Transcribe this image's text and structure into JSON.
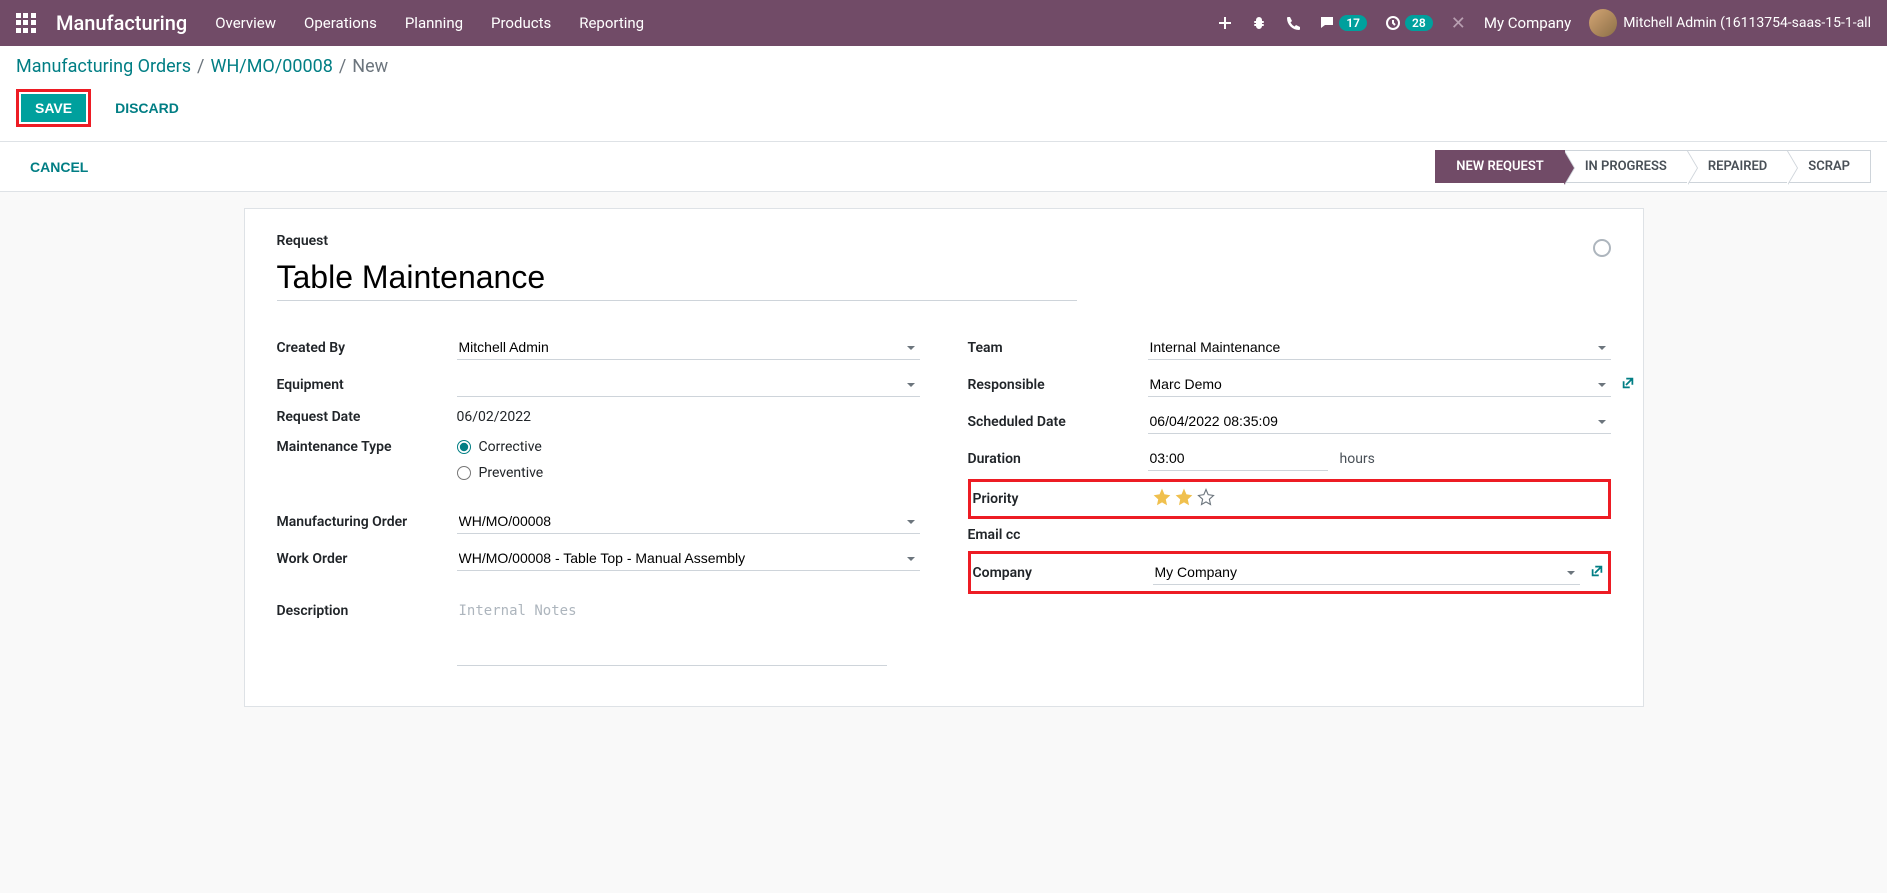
{
  "navbar": {
    "title": "Manufacturing",
    "menu": [
      "Overview",
      "Operations",
      "Planning",
      "Products",
      "Reporting"
    ],
    "messaging_count": "17",
    "activity_count": "28",
    "company": "My Company",
    "user": "Mitchell Admin (16113754-saas-15-1-all"
  },
  "breadcrumb": {
    "root": "Manufacturing Orders",
    "parent": "WH/MO/00008",
    "current": "New"
  },
  "buttons": {
    "save": "Save",
    "discard": "Discard",
    "cancel": "Cancel"
  },
  "statusbar": [
    "NEW REQUEST",
    "IN PROGRESS",
    "REPAIRED",
    "SCRAP"
  ],
  "form": {
    "request_label": "Request",
    "title": "Table Maintenance",
    "left": {
      "created_by_label": "Created By",
      "created_by": "Mitchell Admin",
      "equipment_label": "Equipment",
      "equipment": "",
      "request_date_label": "Request Date",
      "request_date": "06/02/2022",
      "maintenance_type_label": "Maintenance Type",
      "corrective": "Corrective",
      "preventive": "Preventive",
      "mo_label": "Manufacturing Order",
      "mo": "WH/MO/00008",
      "wo_label": "Work Order",
      "wo": "WH/MO/00008 - Table Top - Manual Assembly"
    },
    "right": {
      "team_label": "Team",
      "team": "Internal Maintenance",
      "responsible_label": "Responsible",
      "responsible": "Marc Demo",
      "scheduled_label": "Scheduled Date",
      "scheduled": "06/04/2022 08:35:09",
      "duration_label": "Duration",
      "duration": "03:00",
      "duration_unit": "hours",
      "priority_label": "Priority",
      "email_label": "Email cc",
      "company_label": "Company",
      "company": "My Company"
    },
    "desc_label": "Description",
    "desc_placeholder": "Internal Notes"
  }
}
